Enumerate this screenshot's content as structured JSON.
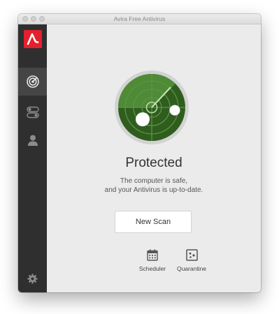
{
  "window": {
    "title": "Avira Free Antivirus"
  },
  "sidebar": {
    "items": [
      {
        "name": "status",
        "icon": "radar-icon",
        "active": true
      },
      {
        "name": "modules",
        "icon": "toggle-switches-icon",
        "active": false
      },
      {
        "name": "account",
        "icon": "user-icon",
        "active": false
      },
      {
        "name": "settings",
        "icon": "gear-icon",
        "active": false
      }
    ],
    "logo_icon": "avira-logo-icon"
  },
  "main": {
    "status_title": "Protected",
    "status_line1": "The computer is safe,",
    "status_line2": "and your Antivirus is up-to-date.",
    "scan_button_label": "New Scan",
    "tools": [
      {
        "label": "Scheduler",
        "icon": "calendar-icon"
      },
      {
        "label": "Quarantine",
        "icon": "quarantine-icon"
      }
    ]
  },
  "colors": {
    "brand_red": "#e4202e",
    "radar_green_dark": "#2f5d1e",
    "radar_green_light": "#4f8a37",
    "sidebar_bg": "#2f2f2f"
  }
}
